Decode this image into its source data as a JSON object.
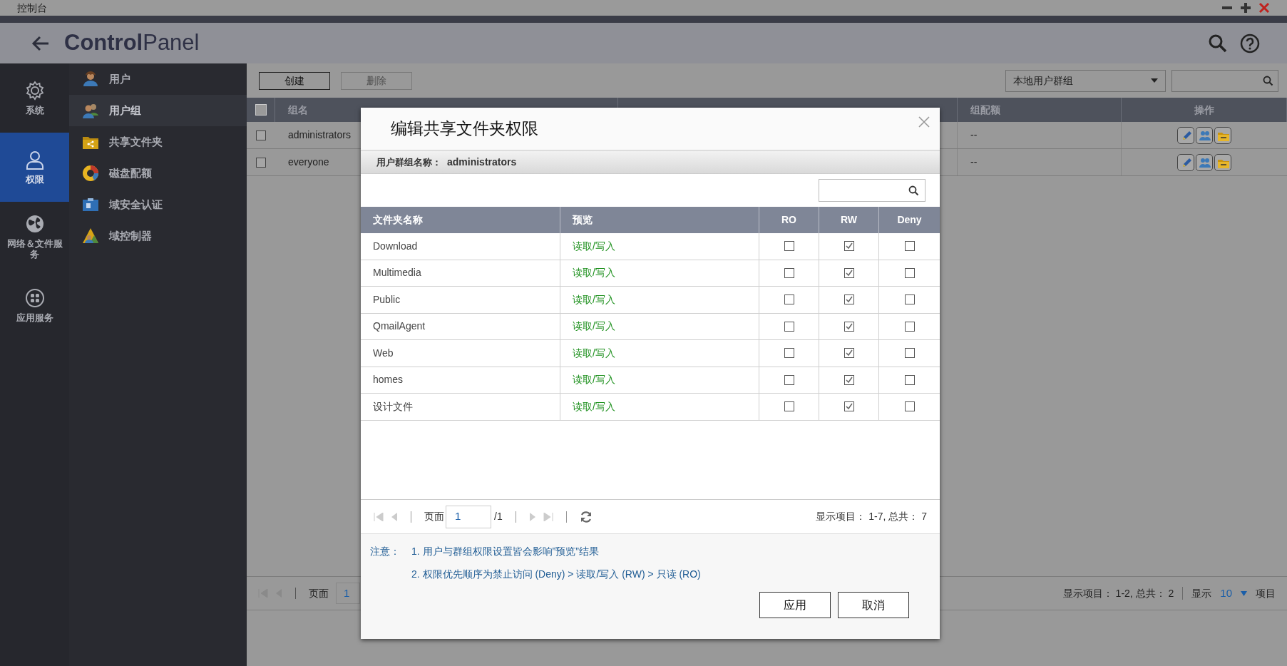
{
  "window": {
    "title": "控制台"
  },
  "app": {
    "title_bold": "Control",
    "title_light": "Panel"
  },
  "rail": [
    {
      "label": "系统",
      "kind": "gear",
      "selected": false
    },
    {
      "label": "权限",
      "kind": "person",
      "selected": true
    },
    {
      "label": "网络＆文件服务",
      "kind": "globe",
      "selected": false
    },
    {
      "label": "应用服务",
      "kind": "apps",
      "selected": false
    }
  ],
  "sidebar": [
    {
      "label": "用户",
      "kind": "user",
      "selected": false
    },
    {
      "label": "用户组",
      "kind": "group",
      "selected": true
    },
    {
      "label": "共享文件夹",
      "kind": "folder",
      "selected": false
    },
    {
      "label": "磁盘配额",
      "kind": "quota",
      "selected": false
    },
    {
      "label": "域安全认证",
      "kind": "card",
      "selected": false
    },
    {
      "label": "域控制器",
      "kind": "domain",
      "selected": false
    }
  ],
  "toolbar": {
    "buttons": [
      {
        "label": "创建",
        "disabled": false
      },
      {
        "label": "删除",
        "disabled": true
      }
    ],
    "filter": "本地用户群组"
  },
  "table": {
    "select_all_checked": false,
    "columns": [
      "组名",
      "组配额",
      "操作"
    ],
    "rows": [
      {
        "name": "administrators",
        "quota": "--",
        "checked": false
      },
      {
        "name": "everyone",
        "quota": "--",
        "checked": false
      }
    ]
  },
  "pager": {
    "page_label": "页面",
    "page": "1",
    "summary": "显示项目： 1-2, 总共： 2",
    "show_label": "显示",
    "per_page": "10",
    "items_label": "项目"
  },
  "dialog": {
    "title": "编辑共享文件夹权限",
    "group_label": "用户群组名称：",
    "group_name": "administrators",
    "columns": [
      "文件夹名称",
      "预览",
      "RO",
      "RW",
      "Deny"
    ],
    "rows": [
      {
        "name": "Download",
        "preview": "读取/写入",
        "ro": false,
        "rw": true,
        "deny": false
      },
      {
        "name": "Multimedia",
        "preview": "读取/写入",
        "ro": false,
        "rw": true,
        "deny": false
      },
      {
        "name": "Public",
        "preview": "读取/写入",
        "ro": false,
        "rw": true,
        "deny": false
      },
      {
        "name": "QmailAgent",
        "preview": "读取/写入",
        "ro": false,
        "rw": true,
        "deny": false
      },
      {
        "name": "Web",
        "preview": "读取/写入",
        "ro": false,
        "rw": true,
        "deny": false
      },
      {
        "name": "homes",
        "preview": "读取/写入",
        "ro": false,
        "rw": true,
        "deny": false
      },
      {
        "name": "设计文件",
        "preview": "读取/写入",
        "ro": false,
        "rw": true,
        "deny": false
      }
    ],
    "pager": {
      "page_label": "页面",
      "page": "1",
      "total": "/1",
      "summary": "显示项目： 1-7, 总共： 7"
    },
    "note_label": "注意：",
    "notes": [
      "1. 用户与群组权限设置皆会影响”预览”结果",
      "2. 权限优先顺序为禁止访问 (Deny) > 读取/写入 (RW) > 只读 (RO)"
    ],
    "buttons": [
      "应用",
      "取消"
    ]
  }
}
